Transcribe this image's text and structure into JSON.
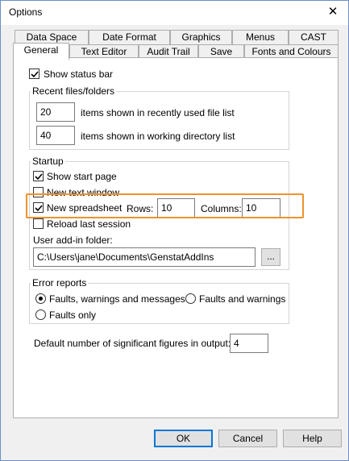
{
  "window": {
    "title": "Options",
    "close_symbol": "✕"
  },
  "tabs_row1": [
    "Data Space",
    "Date Format",
    "Graphics",
    "Menus",
    "CAST"
  ],
  "tabs_row2": [
    "General",
    "Text Editor",
    "Audit Trail",
    "Save",
    "Fonts and Colours"
  ],
  "active_tab": "General",
  "general": {
    "show_status_bar": {
      "label": "Show status bar",
      "checked": true
    },
    "recent": {
      "title": "Recent files/folders",
      "file_list_value": "20",
      "file_list_label": "items shown in recently used file list",
      "dir_list_value": "40",
      "dir_list_label": "items shown in working directory list"
    },
    "startup": {
      "title": "Startup",
      "show_start_page": {
        "label": "Show start page",
        "checked": true
      },
      "new_text_window": {
        "label": "New text window",
        "checked": false
      },
      "new_spreadsheet": {
        "label": "New spreadsheet",
        "checked": true
      },
      "rows_label": "Rows:",
      "rows_value": "10",
      "columns_label": "Columns:",
      "columns_value": "10",
      "reload_last_session": {
        "label": "Reload last session",
        "checked": false
      },
      "addin_label": "User add-in folder:",
      "addin_path": "C:\\Users\\jane\\Documents\\GenstatAddIns",
      "browse_label": "..."
    },
    "error_reports": {
      "title": "Error reports",
      "options": [
        "Faults, warnings and messages",
        "Faults and warnings",
        "Faults only"
      ],
      "selected": "Faults, warnings and messages"
    },
    "sig_figs_label": "Default number of significant figures in output:",
    "sig_figs_value": "4"
  },
  "buttons": {
    "ok": "OK",
    "cancel": "Cancel",
    "help": "Help"
  },
  "colors": {
    "highlight": "#f0922d",
    "default_button_border": "#0078d7"
  }
}
